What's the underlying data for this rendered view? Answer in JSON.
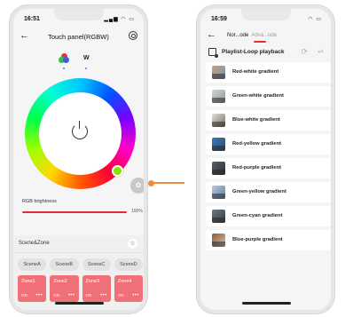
{
  "left_phone": {
    "time": "16:51",
    "status_icons": "▂▄▆ ◠ ▭",
    "back_glyph": "←",
    "title": "Touch panel(RGBW)",
    "modes": {
      "w_label": "W"
    },
    "power_glyph": "",
    "brightness": {
      "label": "RGB brightness",
      "value_text": "100%",
      "value": 100
    },
    "scene": {
      "title": "Scene&Zone",
      "star_glyph": "☆",
      "scenes": [
        "SceneA",
        "SceneB",
        "SceneC",
        "SceneD"
      ],
      "zones": [
        {
          "name": "Zone1",
          "state": "ON",
          "more": "•••"
        },
        {
          "name": "Zone2",
          "state": "ON",
          "more": "•••"
        },
        {
          "name": "Zone3",
          "state": "ON",
          "more": "•••"
        },
        {
          "name": "Zone4",
          "state": "ON",
          "more": "•••"
        }
      ]
    }
  },
  "right_phone": {
    "time": "16:59",
    "status_icons": "◠ ▭",
    "back_glyph": "←",
    "tabs": {
      "active": "Nor...ode",
      "inactive": "Adva...ode"
    },
    "playlist": {
      "label": "Playlist-Loop playback",
      "loop_glyph": "⟳",
      "filter_glyph": "⇌"
    },
    "items": [
      {
        "label": "Red-white gradient"
      },
      {
        "label": "Green-white gradient"
      },
      {
        "label": "Blue-white gradient"
      },
      {
        "label": "Red-yellow gradient"
      },
      {
        "label": "Red-purple gradient"
      },
      {
        "label": "Green-yellow gradient"
      },
      {
        "label": "Green-cyan gradient"
      },
      {
        "label": "Blue-purple gradient"
      }
    ]
  },
  "colors": {
    "accent_red": "#e22a3d",
    "zone_tile": "#f07078",
    "connector": "#f08a3c"
  }
}
